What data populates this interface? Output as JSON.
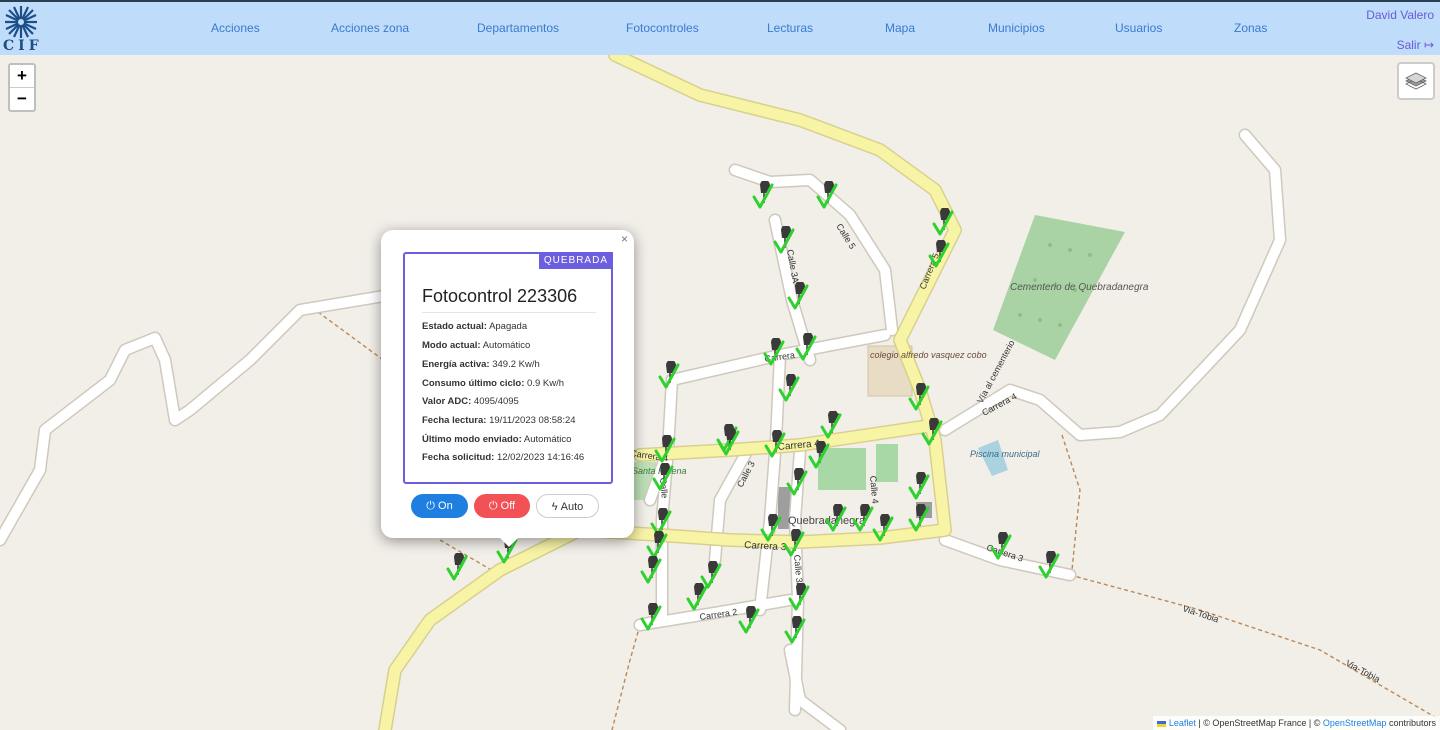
{
  "brand": {
    "logo_text": "CIF"
  },
  "nav": [
    {
      "label": "Acciones"
    },
    {
      "label": "Acciones zona"
    },
    {
      "label": "Departamentos"
    },
    {
      "label": "Fotocontroles"
    },
    {
      "label": "Lecturas"
    },
    {
      "label": "Mapa"
    },
    {
      "label": "Municipios"
    },
    {
      "label": "Usuarios"
    },
    {
      "label": "Zonas"
    }
  ],
  "user": {
    "name": "David Valero",
    "logout_label": "Salir"
  },
  "map": {
    "zoom_in": "+",
    "zoom_out": "−",
    "labels": {
      "calle5": "Calle 5",
      "calle3a_top": "Calle 3A",
      "carrera5": "Carrera 5",
      "carrera_mid": "Carrera",
      "carrera4": "Carrera 4",
      "carrera4_e": "Carrera 4",
      "calle3": "Calle 3",
      "calle4": "Calle 4",
      "carrera3": "Carrera 3",
      "carrera3_e": "Carrera 3",
      "calle3a_bot": "Calle 3A",
      "carrera2": "Carrera 2",
      "calle_w": "Calle",
      "carrera_w": "Carrera 4",
      "santa_helena": "Santa Helena",
      "quebradanegra": "Quebradanegra",
      "cementerio": "Cementerio de Quebradanegra",
      "colegio": "colegio alfredo vasquez cobo",
      "via_cementerio": "Vía al cementerio",
      "piscina": "Piscina municipal",
      "via_tobia_1": "Via-Tobia",
      "via_tobia_2": "Via-Tobia"
    },
    "attribution": {
      "leaflet": "Leaflet",
      "osm_france": "| © OpenStreetMap France | ©",
      "osm": "OpenStreetMap",
      "contributors": "contributors"
    }
  },
  "popup": {
    "close": "×",
    "status_badge": "QUEBRADA",
    "title": "Fotocontrol 223306",
    "fields": [
      {
        "label": "Estado actual:",
        "value": "Apagada"
      },
      {
        "label": "Modo actual:",
        "value": "Automático"
      },
      {
        "label": "Energía activa:",
        "value": "349.2 Kw/h"
      },
      {
        "label": "Consumo último ciclo:",
        "value": "0.9 Kw/h"
      },
      {
        "label": "Valor ADC:",
        "value": "4095/4095"
      },
      {
        "label": "Fecha lectura:",
        "value": "19/11/2023 08:58:24"
      },
      {
        "label": "Último modo enviado:",
        "value": "Automático"
      },
      {
        "label": "Fecha solicitud:",
        "value": "12/02/2023 14:16:46"
      }
    ],
    "buttons": {
      "on": "On",
      "off": "Off",
      "auto": "Auto"
    }
  },
  "colors": {
    "accent": "#6b5fe0",
    "on": "#1e7fe0",
    "off": "#f25156",
    "check": "#2fd12f"
  }
}
